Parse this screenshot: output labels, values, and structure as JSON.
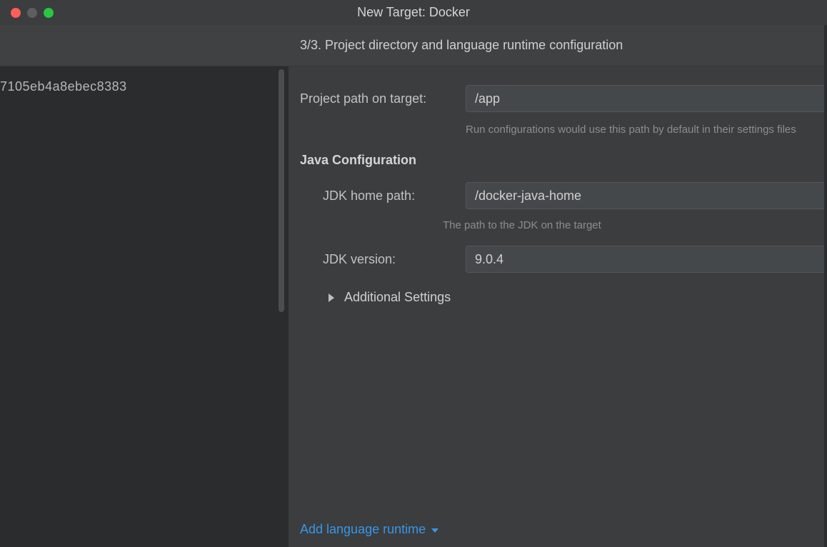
{
  "window": {
    "title": "New Target: Docker"
  },
  "step": {
    "heading": "3/3. Project directory and language runtime configuration"
  },
  "sidebar": {
    "item": "7105eb4a8ebec8383"
  },
  "project_path": {
    "label": "Project path on target:",
    "value": "/app",
    "hint": "Run configurations would use this path by default in their settings files"
  },
  "java": {
    "section": "Java Configuration",
    "jdk_home": {
      "label": "JDK home path:",
      "value": "/docker-java-home",
      "hint": "The path to the JDK on the target"
    },
    "jdk_version": {
      "label": "JDK version:",
      "value": "9.0.4"
    },
    "additional": "Additional Settings"
  },
  "footer": {
    "add_runtime": "Add language runtime"
  }
}
